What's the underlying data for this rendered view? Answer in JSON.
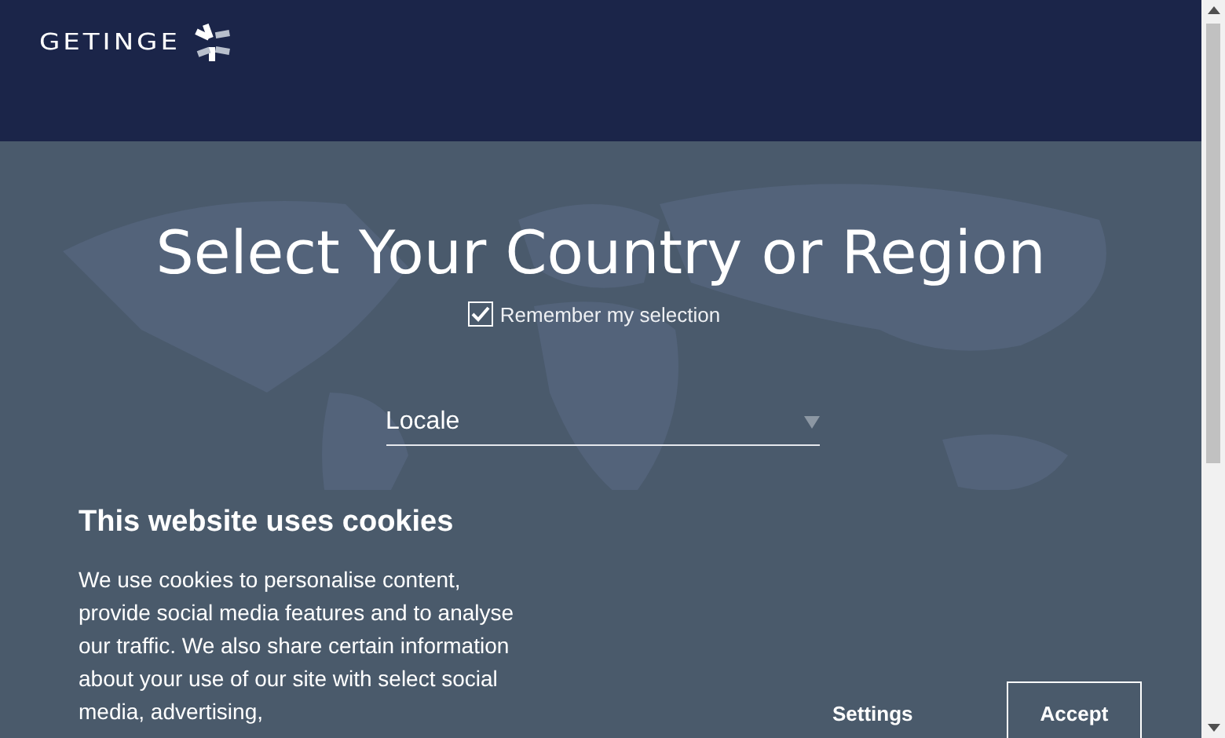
{
  "header": {
    "logo_text": "GETINGE"
  },
  "hero": {
    "title": "Select Your Country or Region",
    "remember": {
      "label": "Remember my selection",
      "checked": true
    },
    "locale_select": {
      "placeholder": "Locale"
    }
  },
  "cookie_banner": {
    "title": "This website uses cookies",
    "text": "We use cookies to personalise content, provide social media features and to analyse our traffic. We also share certain information about your use of our site with select social media, advertising,",
    "buttons": [
      {
        "label": "Settings",
        "kind": "link"
      },
      {
        "label": "Accept",
        "kind": "outline"
      }
    ]
  }
}
